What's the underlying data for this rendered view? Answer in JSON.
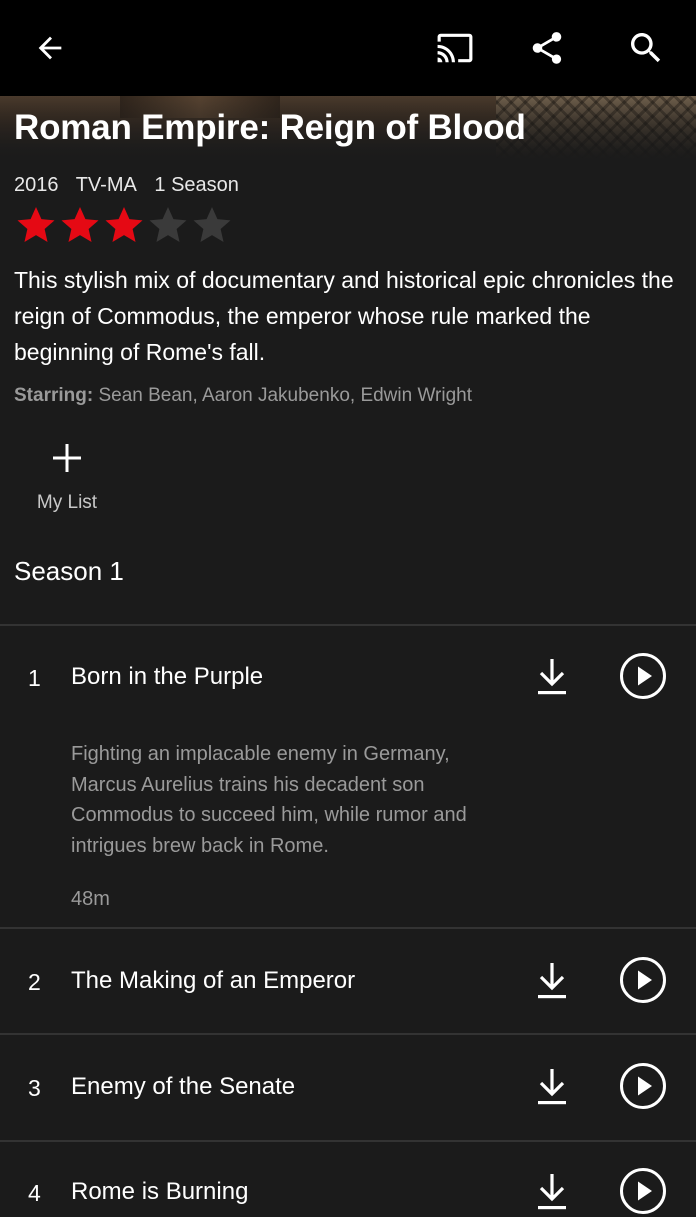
{
  "show": {
    "title": "Roman Empire: Reign of Blood",
    "year": "2016",
    "rating": "TV-MA",
    "seasons": "1 Season",
    "user_rating": 3,
    "max_rating": 5,
    "description": "This stylish mix of documentary and historical epic chronicles the reign of Commodus, the emperor whose rule marked the beginning of Rome's fall.",
    "starring_label": "Starring:",
    "starring": "Sean Bean, Aaron Jakubenko, Edwin Wright"
  },
  "actions": {
    "my_list_label": "My List"
  },
  "season": {
    "label": "Season 1"
  },
  "episodes": [
    {
      "number": "1",
      "title": "Born in the Purple",
      "description": "Fighting an implacable enemy in Germany, Marcus Aurelius trains his decadent son Commodus to succeed him, while rumor and intrigues brew back in Rome.",
      "duration": "48m"
    },
    {
      "number": "2",
      "title": "The Making of an Emperor"
    },
    {
      "number": "3",
      "title": "Enemy of the Senate"
    },
    {
      "number": "4",
      "title": "Rome is Burning"
    }
  ],
  "icons": {
    "back": "arrow-left-icon",
    "cast": "cast-icon",
    "share": "share-icon",
    "search": "search-icon",
    "add": "plus-icon",
    "download": "download-icon",
    "play": "play-circle-icon"
  },
  "colors": {
    "background": "#1b1b1b",
    "topbar": "#000000",
    "star_active": "#e50914",
    "star_inactive": "#3a3a3a",
    "muted_text": "#9a9a9a"
  }
}
